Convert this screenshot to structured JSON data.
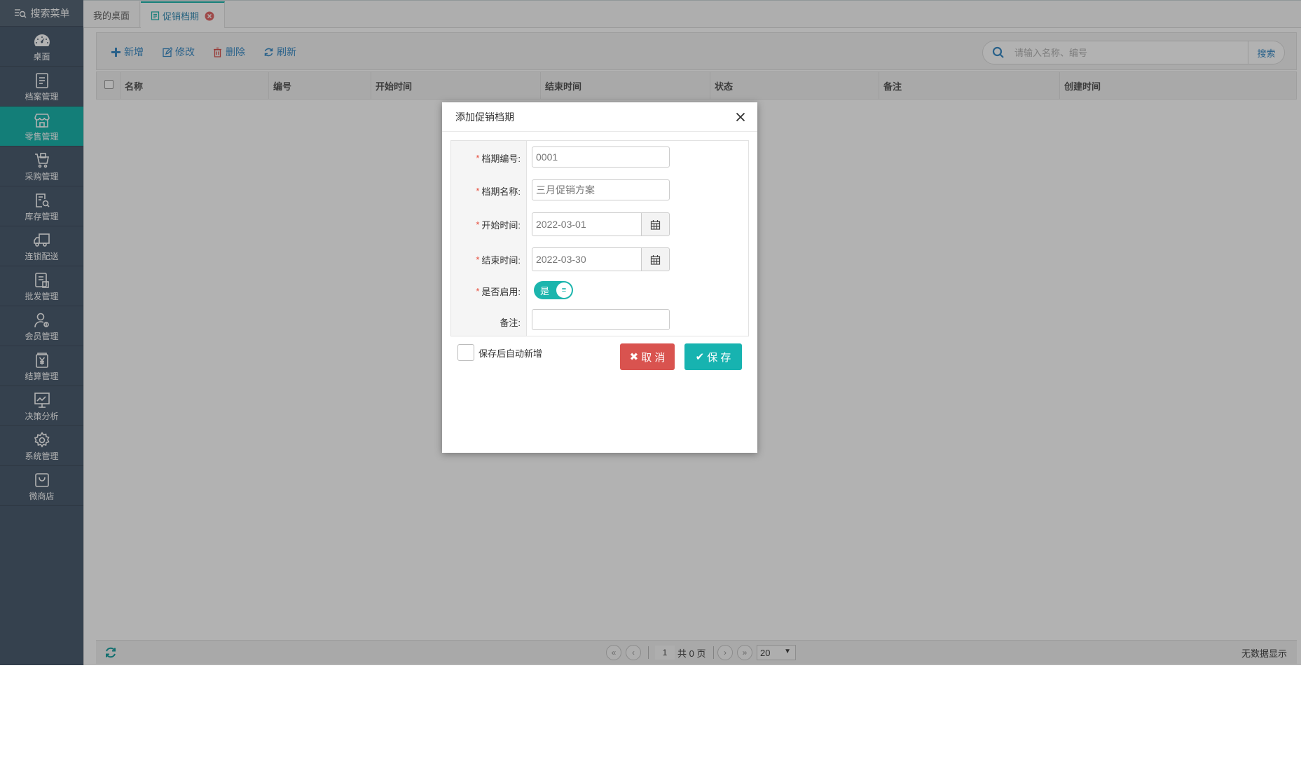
{
  "sidebar": {
    "search_menu": "搜索菜单",
    "items": [
      {
        "label": "桌面"
      },
      {
        "label": "档案管理"
      },
      {
        "label": "零售管理"
      },
      {
        "label": "采购管理"
      },
      {
        "label": "库存管理"
      },
      {
        "label": "连锁配送"
      },
      {
        "label": "批发管理"
      },
      {
        "label": "会员管理"
      },
      {
        "label": "结算管理"
      },
      {
        "label": "决策分析"
      },
      {
        "label": "系统管理"
      },
      {
        "label": "微商店"
      }
    ]
  },
  "tabs": [
    {
      "label": "我的桌面"
    },
    {
      "label": "促销档期"
    }
  ],
  "toolbar": {
    "add": "新增",
    "edit": "修改",
    "delete": "删除",
    "refresh": "刷新",
    "search_placeholder": "请输入名称、编号",
    "search_button": "搜索"
  },
  "grid": {
    "columns": [
      "名称",
      "编号",
      "开始时间",
      "结束时间",
      "状态",
      "备注",
      "创建时间"
    ]
  },
  "pager": {
    "page": "1",
    "total": "共 0 页",
    "page_size": "20",
    "status": "无数据显示"
  },
  "dialog": {
    "title": "添加促销档期",
    "fields": {
      "code_label": "档期编号:",
      "code_value": "0001",
      "name_label": "档期名称:",
      "name_value": "三月促销方案",
      "start_label": "开始时间:",
      "start_value": "2022-03-01",
      "end_label": "结束时间:",
      "end_value": "2022-03-30",
      "enabled_label": "是否启用:",
      "enabled_value": "是",
      "remark_label": "备注:",
      "remark_value": ""
    },
    "required_mark": "*",
    "auto_add_label": "保存后自动新增",
    "cancel_label": "取 消",
    "save_label": "保 存"
  },
  "colors": {
    "sidebar_bg": "#4d5e70",
    "accent": "#1cb5ad",
    "link": "#3b8cc6",
    "cancel": "#d9534f",
    "required": "#e74c3c"
  }
}
